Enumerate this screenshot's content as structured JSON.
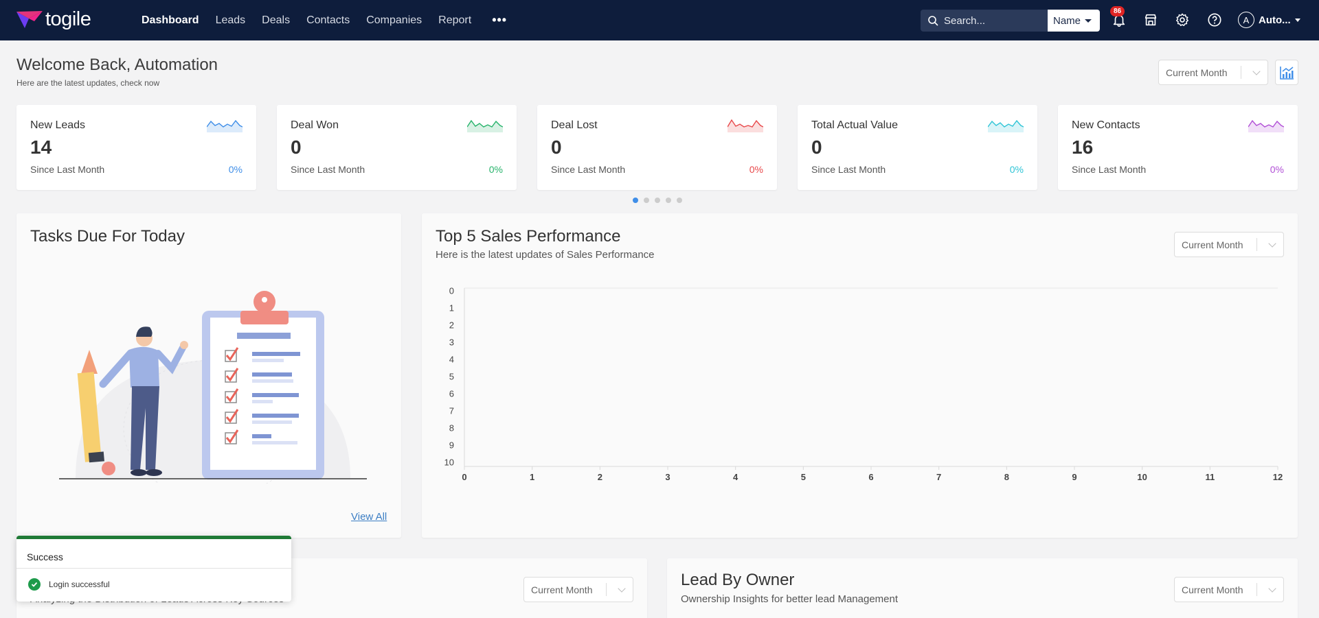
{
  "app": {
    "logo_text": "togile"
  },
  "nav": {
    "links": [
      {
        "label": "Dashboard",
        "active": true
      },
      {
        "label": "Leads"
      },
      {
        "label": "Deals"
      },
      {
        "label": "Contacts"
      },
      {
        "label": "Companies"
      },
      {
        "label": "Report"
      }
    ],
    "more": "•••",
    "search_placeholder": "Search...",
    "search_scope": "Name",
    "notification_count": "86",
    "user_initial": "A",
    "user_name": "Auto..."
  },
  "header": {
    "title": "Welcome Back, Automation",
    "subtitle": "Here are the latest updates, check now",
    "period": "Current Month"
  },
  "stats": [
    {
      "label": "New Leads",
      "value": "14",
      "since": "Since Last Month",
      "pct": "0%",
      "color": "#3f8ee8"
    },
    {
      "label": "Deal Won",
      "value": "0",
      "since": "Since Last Month",
      "pct": "0%",
      "color": "#27b36b"
    },
    {
      "label": "Deal Lost",
      "value": "0",
      "since": "Since Last Month",
      "pct": "0%",
      "color": "#e8484a"
    },
    {
      "label": "Total Actual Value",
      "value": "0",
      "since": "Since Last Month",
      "pct": "0%",
      "color": "#2ec4d6"
    },
    {
      "label": "New Contacts",
      "value": "16",
      "since": "Since Last Month",
      "pct": "0%",
      "color": "#b14fd6"
    }
  ],
  "tasks": {
    "title": "Tasks Due For Today",
    "view_all": "View All"
  },
  "sales": {
    "title": "Top 5 Sales Performance",
    "subtitle": "Here is the latest updates of Sales Performance",
    "period": "Current Month"
  },
  "chart_data": {
    "type": "bar",
    "x_ticks": [
      "0",
      "1",
      "2",
      "3",
      "4",
      "5",
      "6",
      "7",
      "8",
      "9",
      "10",
      "11",
      "12"
    ],
    "y_ticks": [
      "0",
      "1",
      "2",
      "3",
      "4",
      "5",
      "6",
      "7",
      "8",
      "9",
      "10"
    ],
    "series": [],
    "xlim": [
      0,
      12
    ],
    "ylim": [
      0,
      10
    ],
    "grid": false
  },
  "lead_source": {
    "subtitle": "Analyzing the Distribution of Leads Across Key Sources",
    "period": "Current Month"
  },
  "lead_owner": {
    "title": "Lead By Owner",
    "subtitle": "Ownership Insights for better lead Management",
    "period": "Current Month"
  },
  "toast": {
    "title": "Success",
    "message": "Login successful",
    "accent": "#1f7a36"
  }
}
